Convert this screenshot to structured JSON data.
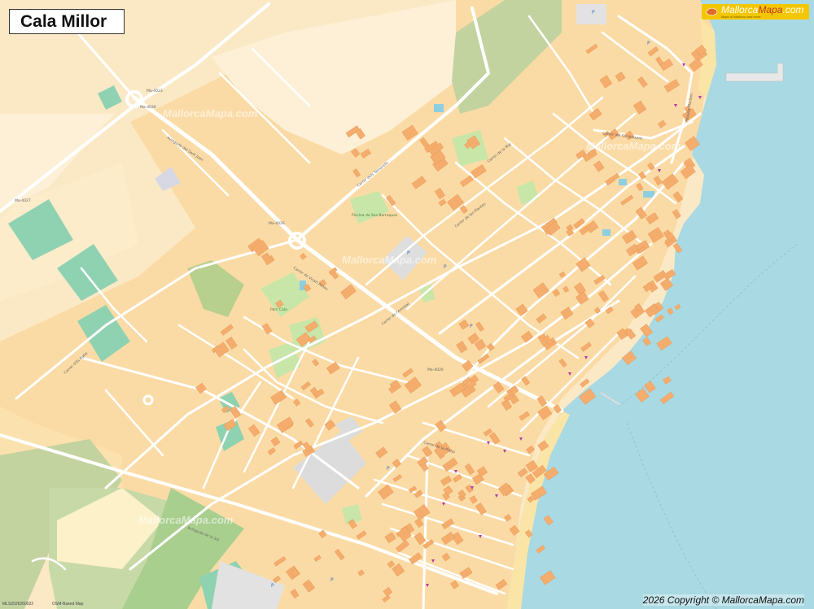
{
  "map": {
    "title": "Cala Millor",
    "logo": {
      "brand_a": "Mallorca",
      "brand_b": "Mapa",
      "tld": ".com",
      "tagline": "Maps of Mallorca and more"
    },
    "copyright": "2026 Copyright © MallorcaMapa.com",
    "credit_left": "MLS2026260022",
    "credit_osm": "OSM-Based Map",
    "watermark": "MallorcaMapa.com",
    "colors": {
      "land": "#fbe9c6",
      "urban": "#fbd9a4",
      "building": "#f5ad6d",
      "road": "#ffffff",
      "sea": "#a9d9e3",
      "park": "#c8e6a8",
      "sport": "#8fd2b2",
      "forest": "#c3d3a0",
      "beach": "#fbe5a6"
    },
    "road_labels": [
      "Ma-4023",
      "Ma-4026",
      "Ma-4027",
      "Ma-4026",
      "Ma-4026",
      "Avinguda del Sant Joan",
      "Carrer de Vicari Arnau",
      "Carrer dels Tamarells",
      "Carrer de l'Amistat",
      "Carrer de les Plantes",
      "Carrer de la Mar",
      "Carrer del Sol Naixent",
      "Avinguda de la Sol",
      "Carrer d'Es Rafal",
      "Carrer de la Platja",
      "Passeig Marítim"
    ],
    "poi_labels": [
      "Parc Cala",
      "Piscina de Ses Barraques"
    ]
  }
}
